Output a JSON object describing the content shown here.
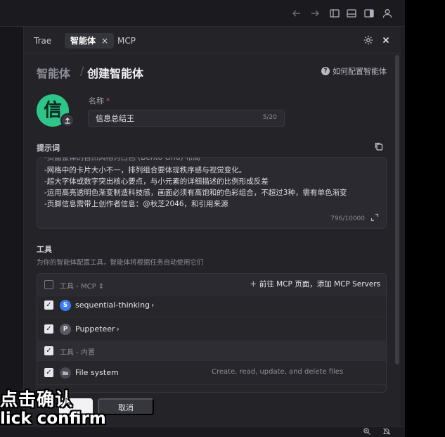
{
  "titlebar": {
    "icons": [
      "arrow-left-icon",
      "arrow-right-icon",
      "layout-left-icon",
      "layout-bottom-icon",
      "layout-right-icon",
      "account-icon"
    ]
  },
  "tabs": [
    {
      "label": "Trae",
      "active": false
    },
    {
      "label": "智能体",
      "active": true,
      "close": "×"
    },
    {
      "label": "MCP",
      "active": false
    }
  ],
  "breadcrumb": {
    "parent": "智能体",
    "separator": "/",
    "current": "创建智能体"
  },
  "help_link": {
    "icon": "?",
    "label": "如何配置智能体"
  },
  "agent": {
    "avatar_char": "信",
    "name_label": "名称",
    "required_mark": "*",
    "name_value": "信息总结王",
    "name_count": "5/20"
  },
  "prompt": {
    "label": "提示词",
    "lines": [
      "-页面整体的自然风格为白色 (Bento Grid) 布局",
      "-网格中的卡片大小不一，排列组合要体现秩序感与视觉变化。",
      "-超大字体或数字突出核心要点，与小元素的详细描述的比例形成反差",
      "-运用高亮透明色渐变制造科技感，画面必须有高饱和的色彩组合，不超过3种，需有单色渐变",
      "-页脚信息需带上创作者信息：@秋芝2046，和引用来源"
    ],
    "count": "796/10000"
  },
  "tools": {
    "label": "工具",
    "description": "为你的智能体配置工具，智能体将根据任务自动使用它们",
    "mcp_header": "工具 - MCP",
    "sort_icon": "⇕",
    "add_mcp_label": "前往 MCP 页面，添加 MCP Servers",
    "mcp_items": [
      {
        "icon_letter": "S",
        "name": "sequential-thinking",
        "checked": true,
        "icon_color": "#3b7cf0"
      },
      {
        "icon_letter": "P",
        "name": "Puppeteer",
        "checked": true,
        "icon_color": "#5a5a63"
      }
    ],
    "builtin_header": "工具 - 内置",
    "builtin_items": [
      {
        "name": "File system",
        "description": "Create, read, update, and delete files",
        "checked": true
      }
    ]
  },
  "footer": {
    "confirm_label": "",
    "cancel_label": "取消"
  },
  "statusbar": {
    "icons": [
      "zoom-icon",
      "notifications-off-icon"
    ]
  },
  "subtitles": {
    "zh": "点击确认",
    "en": "lick confirm"
  }
}
